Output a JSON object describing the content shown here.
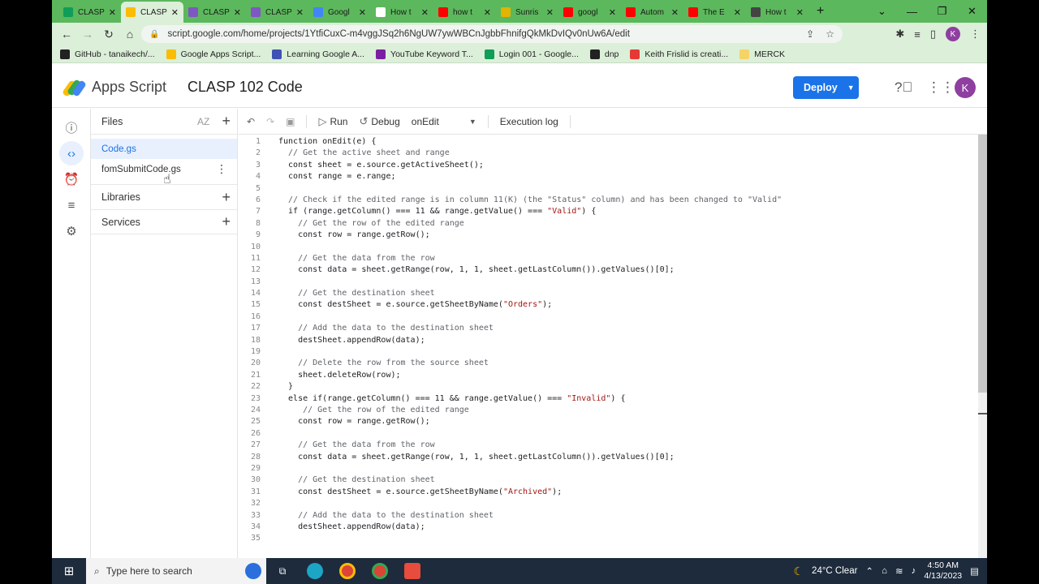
{
  "tabs": [
    {
      "label": "CLASP",
      "fav_color": "#0f9d58",
      "active": false
    },
    {
      "label": "CLASP",
      "fav_color": "#fbbc04",
      "active": true
    },
    {
      "label": "CLASP",
      "fav_color": "#7e57c2",
      "active": false
    },
    {
      "label": "CLASP",
      "fav_color": "#7e57c2",
      "active": false
    },
    {
      "label": "Googl",
      "fav_color": "#4285f4",
      "active": false
    },
    {
      "label": "How t",
      "fav_color": "#ffffff",
      "active": false
    },
    {
      "label": "how t",
      "fav_color": "#ff0000",
      "active": false
    },
    {
      "label": "Sunris",
      "fav_color": "#e0b400",
      "active": false
    },
    {
      "label": "googl",
      "fav_color": "#ff0000",
      "active": false
    },
    {
      "label": "Autom",
      "fav_color": "#ff0000",
      "active": false
    },
    {
      "label": "The E",
      "fav_color": "#ff0000",
      "active": false
    },
    {
      "label": "How t",
      "fav_color": "#444444",
      "active": false
    }
  ],
  "browser": {
    "url": "script.google.com/home/projects/1YtfiCuxC-m4vggJSq2h6NgUW7ywWBCnJgbbFhnifgQkMkDvIQv0nUw6A/edit",
    "profile_initial": "K"
  },
  "bookmarks": [
    {
      "label": "GitHub - tanaikech/...",
      "color": "#222222"
    },
    {
      "label": "Google Apps Script...",
      "color": "#fbbc04"
    },
    {
      "label": "Learning Google A...",
      "color": "#3f51b5"
    },
    {
      "label": "YouTube Keyword T...",
      "color": "#7b1fa2"
    },
    {
      "label": "Login 001 - Google...",
      "color": "#0f9d58"
    },
    {
      "label": "dnp",
      "color": "#222222"
    },
    {
      "label": "Keith Frislid is creati...",
      "color": "#e53935"
    },
    {
      "label": "MERCK",
      "color": "#f6d365"
    }
  ],
  "header": {
    "brand": "Apps Script",
    "project_title": "CLASP 102 Code",
    "deploy_label": "Deploy",
    "avatar_initial": "K"
  },
  "files_panel": {
    "title": "Files",
    "sort_label": "AZ",
    "files": [
      "Code.gs",
      "fomSubmitCode.gs"
    ],
    "libraries_label": "Libraries",
    "services_label": "Services"
  },
  "editor_toolbar": {
    "run_label": "Run",
    "debug_label": "Debug",
    "function_name": "onEdit",
    "exec_log_label": "Execution log"
  },
  "code_lines": [
    "function onEdit(e) {",
    "  // Get the active sheet and range",
    "  const sheet = e.source.getActiveSheet();",
    "  const range = e.range;",
    "",
    "  // Check if the edited range is in column 11(K) (the \"Status\" column) and has been changed to \"Valid\"",
    "  if (range.getColumn() === 11 && range.getValue() === \"Valid\") {",
    "    // Get the row of the edited range",
    "    const row = range.getRow();",
    "",
    "    // Get the data from the row",
    "    const data = sheet.getRange(row, 1, 1, sheet.getLastColumn()).getValues()[0];",
    "",
    "    // Get the destination sheet",
    "    const destSheet = e.source.getSheetByName(\"Orders\");",
    "",
    "    // Add the data to the destination sheet",
    "    destSheet.appendRow(data);",
    "",
    "    // Delete the row from the source sheet",
    "    sheet.deleteRow(row);",
    "  }",
    "  else if(range.getColumn() === 11 && range.getValue() === \"Invalid\") {",
    "     // Get the row of the edited range",
    "    const row = range.getRow();",
    "",
    "    // Get the data from the row",
    "    const data = sheet.getRange(row, 1, 1, sheet.getLastColumn()).getValues()[0];",
    "",
    "    // Get the destination sheet",
    "    const destSheet = e.source.getSheetByName(\"Archived\");",
    "",
    "    // Add the data to the destination sheet",
    "    destSheet.appendRow(data);",
    ""
  ],
  "taskbar": {
    "search_placeholder": "Type here to search",
    "weather": "24°C  Clear",
    "time": "4:50 AM",
    "date": "4/13/2023"
  },
  "colors": {
    "chrome_green": "#5cb85c",
    "accent_blue": "#1a73e8",
    "avatar_purple": "#8e3fa0"
  }
}
